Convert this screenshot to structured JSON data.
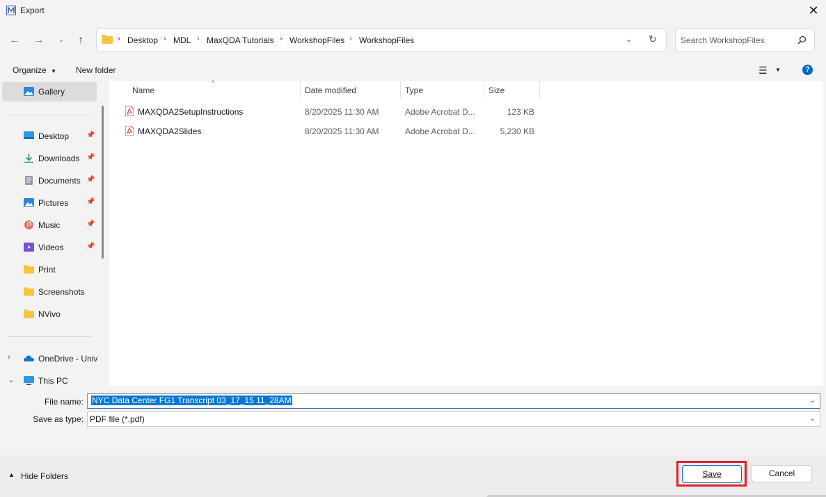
{
  "window": {
    "title": "Export"
  },
  "nav": {
    "breadcrumbs": [
      "Desktop",
      "MDL",
      "MaxQDA Tutorials",
      "WorkshopFiles",
      "WorkshopFiles"
    ],
    "search_placeholder": "Search WorkshopFiles"
  },
  "toolbar": {
    "organize": "Organize",
    "new_folder": "New folder"
  },
  "sidebar": {
    "gallery": "Gallery",
    "quick": [
      {
        "label": "Desktop",
        "icon": "desktop-icon",
        "pinned": true
      },
      {
        "label": "Downloads",
        "icon": "download-icon",
        "pinned": true
      },
      {
        "label": "Documents",
        "icon": "document-icon",
        "pinned": true
      },
      {
        "label": "Pictures",
        "icon": "picture-icon",
        "pinned": true
      },
      {
        "label": "Music",
        "icon": "music-icon",
        "pinned": true
      },
      {
        "label": "Videos",
        "icon": "video-icon",
        "pinned": true
      },
      {
        "label": "Print",
        "icon": "folder-icon",
        "pinned": false
      },
      {
        "label": "Screenshots",
        "icon": "folder-icon",
        "pinned": false
      },
      {
        "label": "NVivo",
        "icon": "folder-icon",
        "pinned": false
      }
    ],
    "onedrive": "OneDrive - Univ",
    "this_pc": "This PC"
  },
  "columns": {
    "name": "Name",
    "date": "Date modified",
    "type": "Type",
    "size": "Size"
  },
  "files": [
    {
      "name": "MAXQDA2SetupInstructions",
      "date": "8/20/2025 11:30 AM",
      "type": "Adobe Acrobat D...",
      "size": "123 KB"
    },
    {
      "name": "MAXQDA2Slides",
      "date": "8/20/2025 11:30 AM",
      "type": "Adobe Acrobat D...",
      "size": "5,230 KB"
    }
  ],
  "form": {
    "file_name_label": "File name:",
    "file_name_value": "NYC Data Center FG1 Transcript 03_17_15 11_28AM",
    "save_as_type_label": "Save as type:",
    "save_as_type_value": "PDF file (*.pdf)"
  },
  "footer": {
    "hide_folders": "Hide Folders",
    "save": "Save",
    "cancel": "Cancel"
  },
  "colors": {
    "accent": "#0078d7",
    "highlight": "#e2202b",
    "pdf": "#d32f2f"
  }
}
